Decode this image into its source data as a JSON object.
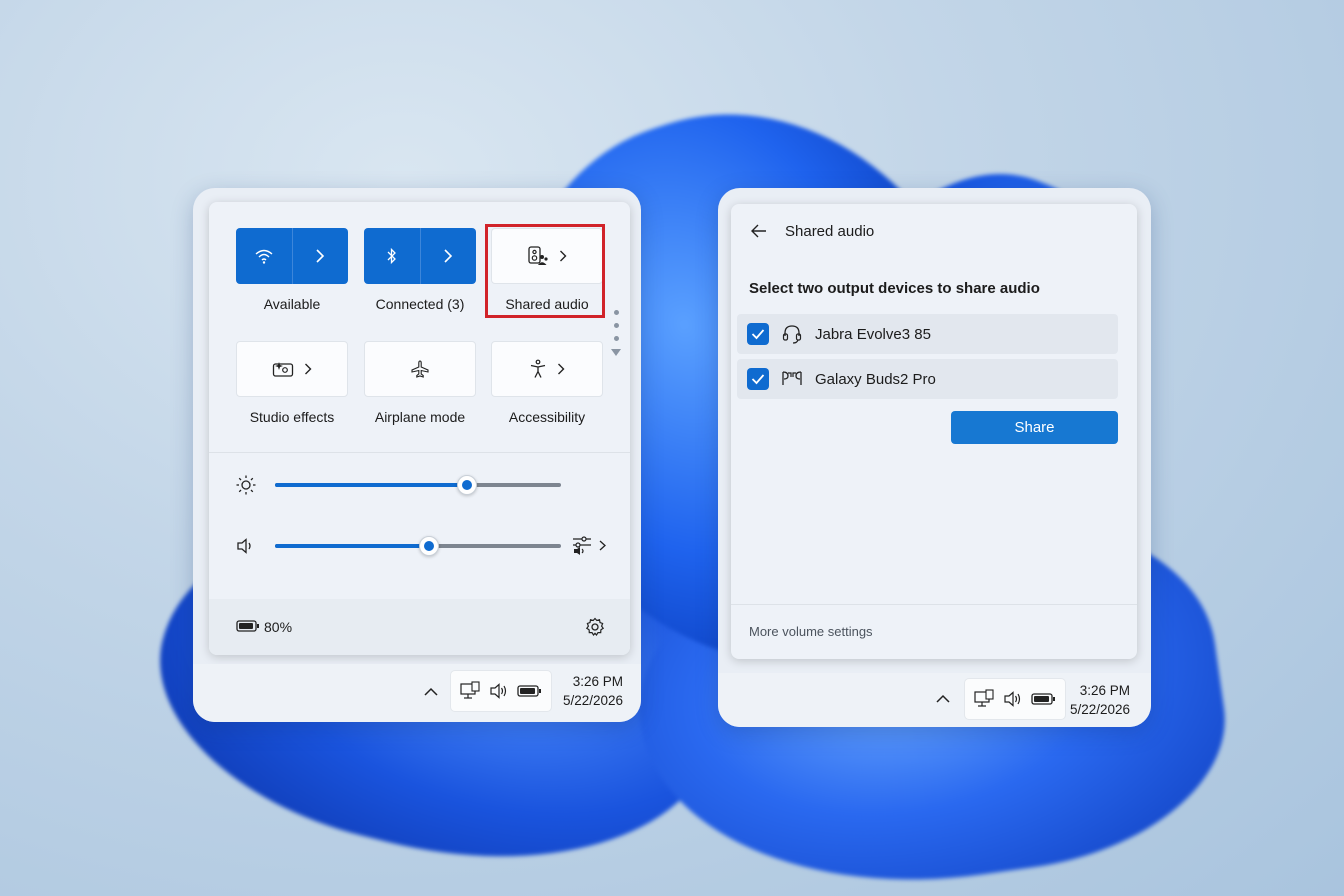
{
  "quick_settings": {
    "tiles": [
      {
        "label": "Available",
        "state": "on",
        "icon": "wifi-icon"
      },
      {
        "label": "Connected (3)",
        "state": "on",
        "icon": "bluetooth-icon"
      },
      {
        "label": "Shared audio",
        "state": "off",
        "icon": "shared-audio-icon"
      },
      {
        "label": "Studio effects",
        "state": "off",
        "icon": "studio-effects-icon"
      },
      {
        "label": "Airplane mode",
        "state": "off",
        "icon": "airplane-icon"
      },
      {
        "label": "Accessibility",
        "state": "off",
        "icon": "accessibility-icon"
      }
    ],
    "brightness_level": 0.67,
    "volume_level": 0.54,
    "battery_text": "80%",
    "accent_color": "#0f6bd0",
    "highlight_color": "#d1232a"
  },
  "shared_audio": {
    "title": "Shared audio",
    "heading": "Select two output devices to share audio",
    "devices": [
      {
        "name": "Jabra Evolve3 85",
        "checked": true,
        "icon": "headset-icon"
      },
      {
        "name": "Galaxy Buds2 Pro",
        "checked": true,
        "icon": "earbuds-icon"
      }
    ],
    "share_label": "Share",
    "more_volume_label": "More volume settings"
  },
  "taskbar": {
    "time": "3:26 PM",
    "date": "5/22/2026"
  }
}
